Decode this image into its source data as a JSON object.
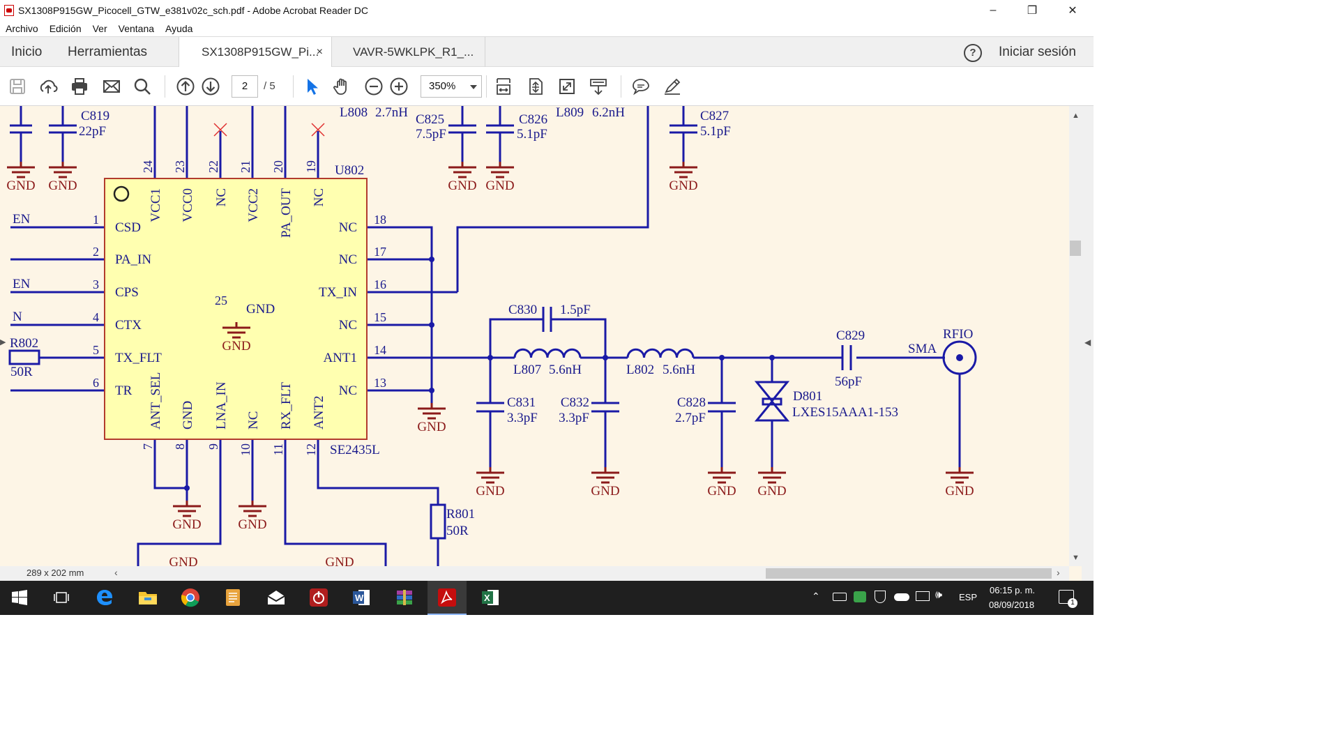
{
  "window": {
    "title": "SX1308P915GW_Picocell_GTW_e381v02c_sch.pdf - Adobe Acrobat Reader DC",
    "controls": [
      "–",
      "❐",
      "✕"
    ]
  },
  "menu": [
    "Archivo",
    "Edición",
    "Ver",
    "Ventana",
    "Ayuda"
  ],
  "nav": {
    "home": "Inicio",
    "tools": "Herramientas",
    "help": "?",
    "signin": "Iniciar sesión"
  },
  "tabs": [
    {
      "label": "SX1308P915GW_Pi...",
      "close": "×"
    },
    {
      "label": "VAVR-5WKLPK_R1_..."
    }
  ],
  "toolbar": {
    "page_current": "2",
    "page_total": "/ 5",
    "zoom": "350%"
  },
  "status": {
    "page_size": "289 x 202 mm"
  },
  "schematic": {
    "ic": {
      "ref": "U802",
      "part": "SE2435L"
    },
    "left_pins": [
      {
        "num": "1",
        "name": "CSD",
        "net": "EN"
      },
      {
        "num": "2",
        "name": "PA_IN",
        "net": ""
      },
      {
        "num": "3",
        "name": "CPS",
        "net": "EN"
      },
      {
        "num": "4",
        "name": "CTX",
        "net": "N"
      },
      {
        "num": "5",
        "name": "TX_FLT",
        "net": ""
      },
      {
        "num": "6",
        "name": "TR",
        "net": ""
      }
    ],
    "right_pins": [
      {
        "num": "18",
        "name": "NC"
      },
      {
        "num": "17",
        "name": "NC"
      },
      {
        "num": "16",
        "name": "TX_IN"
      },
      {
        "num": "15",
        "name": "NC"
      },
      {
        "num": "14",
        "name": "ANT1"
      },
      {
        "num": "13",
        "name": "NC"
      }
    ],
    "top_pins": [
      {
        "num": "24",
        "name": "VCC1"
      },
      {
        "num": "23",
        "name": "VCC0"
      },
      {
        "num": "22",
        "name": "NC"
      },
      {
        "num": "21",
        "name": "VCC2"
      },
      {
        "num": "20",
        "name": "PA_OUT"
      },
      {
        "num": "19",
        "name": "NC"
      }
    ],
    "bottom_pins": [
      {
        "num": "7",
        "name": "ANT_SEL"
      },
      {
        "num": "8",
        "name": "GND"
      },
      {
        "num": "9",
        "name": "LNA_IN"
      },
      {
        "num": "10",
        "name": "NC"
      },
      {
        "num": "11",
        "name": "RX_FLT"
      },
      {
        "num": "12",
        "name": "ANT2"
      }
    ],
    "center_pin": {
      "num": "25",
      "name": "GND"
    },
    "gnd": "GND",
    "components": {
      "c819": {
        "ref": "C819",
        "val": "22pF"
      },
      "l808": {
        "ref": "L808",
        "val": "2.7nH"
      },
      "c825": {
        "ref": "C825",
        "val": "7.5pF"
      },
      "c826": {
        "ref": "C826",
        "val": "5.1pF"
      },
      "l809": {
        "ref": "L809",
        "val": "6.2nH"
      },
      "c827": {
        "ref": "C827",
        "val": "5.1pF"
      },
      "r802": {
        "ref": "R802",
        "val": "50R"
      },
      "c830": {
        "ref": "C830",
        "val": "1.5pF"
      },
      "l807": {
        "ref": "L807",
        "val": "5.6nH"
      },
      "l802": {
        "ref": "L802",
        "val": "5.6nH"
      },
      "c831": {
        "ref": "C831",
        "val": "3.3pF"
      },
      "c832": {
        "ref": "C832",
        "val": "3.3pF"
      },
      "c828": {
        "ref": "C828",
        "val": "2.7pF"
      },
      "d801": {
        "ref": "D801",
        "val": "LXES15AAA1-153"
      },
      "c829": {
        "ref": "C829",
        "val": "56pF"
      },
      "r801": {
        "ref": "R801",
        "val": "50R"
      },
      "rfio": {
        "ref": "RFIO",
        "val": "SMA"
      }
    }
  },
  "tray": {
    "lang": "ESP",
    "time": "06:15 p. m.",
    "date": "08/09/2018",
    "notifications": "1"
  }
}
